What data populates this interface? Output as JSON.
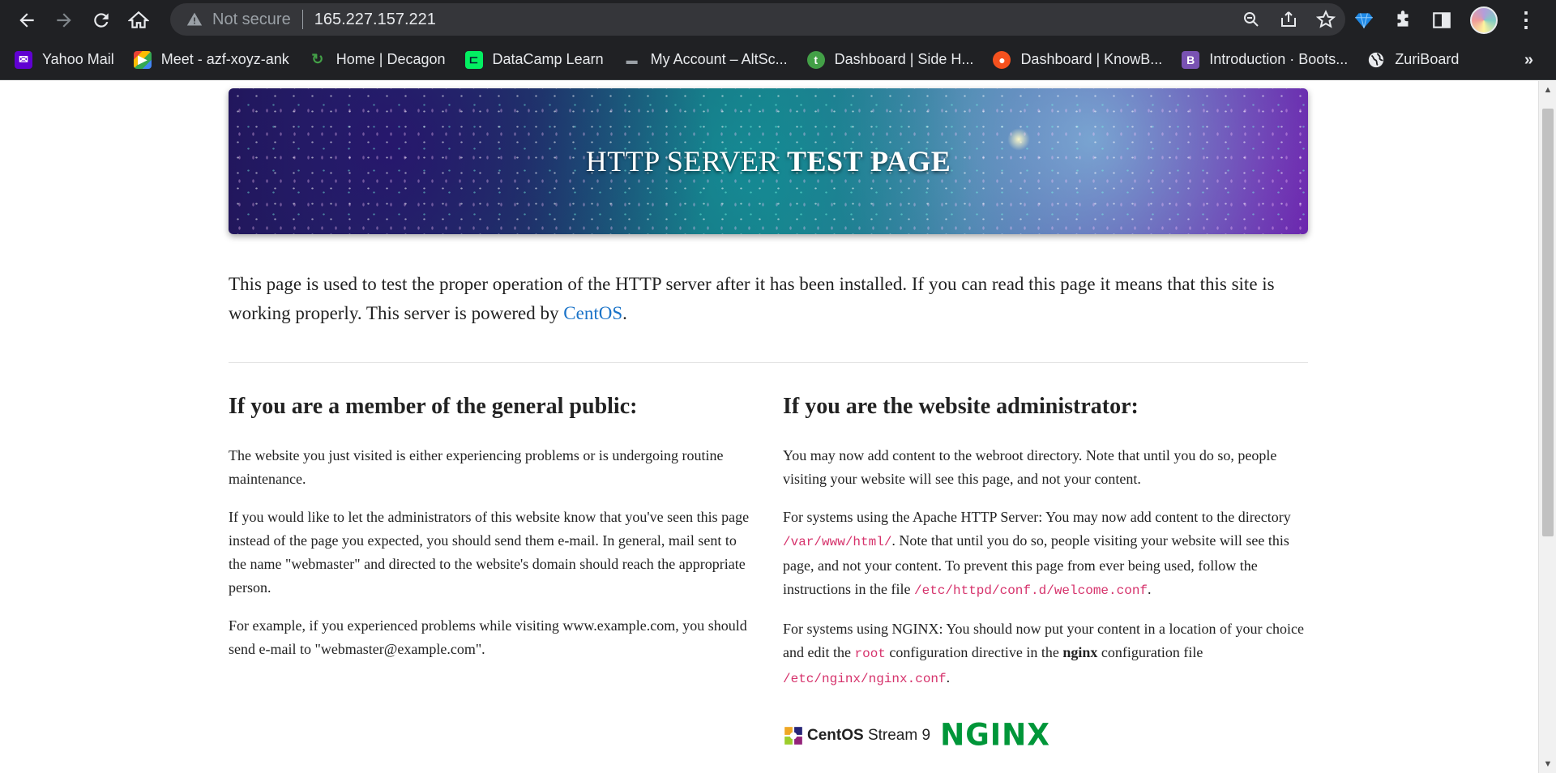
{
  "browser": {
    "security_label": "Not secure",
    "url": "165.227.157.221",
    "bookmarks": [
      {
        "label": "Yahoo Mail",
        "icon": "yahoo-mail-icon",
        "color": "#6001d2"
      },
      {
        "label": "Meet - azf-xoyz-ank",
        "icon": "google-meet-icon",
        "color": "#00897b"
      },
      {
        "label": "Home | Decagon",
        "icon": "decagon-icon",
        "color": "#2e7d32"
      },
      {
        "label": "DataCamp Learn",
        "icon": "datacamp-icon",
        "color": "#03ef62"
      },
      {
        "label": "My Account – AltSc...",
        "icon": "altschool-icon",
        "color": "#3c4043"
      },
      {
        "label": "Dashboard | Side H...",
        "icon": "sidehustle-icon",
        "color": "#43a047"
      },
      {
        "label": "Dashboard | KnowB...",
        "icon": "knowbase-icon",
        "color": "#f4511e"
      },
      {
        "label": "Introduction · Boots...",
        "icon": "bootstrap-icon",
        "color": "#7952b3"
      },
      {
        "label": "ZuriBoard",
        "icon": "globe-icon",
        "color": "#e8eaed"
      }
    ]
  },
  "page": {
    "banner": {
      "title_regular": "HTTP SERVER",
      "title_bold": "TEST PAGE"
    },
    "lead": {
      "text": "This page is used to test the proper operation of the HTTP server after it has been installed. If you can read this page it means that this site is working properly. This server is powered by ",
      "link": "CentOS",
      "end": "."
    },
    "public": {
      "heading": "If you are a member of the general public:",
      "p1": "The website you just visited is either experiencing problems or is undergoing routine maintenance.",
      "p2": "If you would like to let the administrators of this website know that you've seen this page instead of the page you expected, you should send them e-mail. In general, mail sent to the name \"webmaster\" and directed to the website's domain should reach the appropriate person.",
      "p3": "For example, if you experienced problems while visiting www.example.com, you should send e-mail to \"webmaster@example.com\"."
    },
    "admin": {
      "heading": "If you are the website administrator:",
      "p1": "You may now add content to the webroot directory. Note that until you do so, people visiting your website will see this page, and not your content.",
      "p2_a": "For systems using the Apache HTTP Server: You may now add content to the directory ",
      "p2_code1": "/var/www/html/",
      "p2_b": ". Note that until you do so, people visiting your website will see this page, and not your content. To prevent this page from ever being used, follow the instructions in the file ",
      "p2_code2": "/etc/httpd/conf.d/welcome.conf",
      "p2_c": ".",
      "p3_a": "For systems using NGINX: You should now put your content in a location of your choice and edit the ",
      "p3_code1": "root",
      "p3_b": " configuration directive in the ",
      "p3_bold": "nginx",
      "p3_c": " configuration file ",
      "p3_code2": "/etc/nginx/nginx.conf",
      "p3_d": "."
    },
    "logos": {
      "centos_bold": "CentOS",
      "centos_rest": " Stream 9",
      "nginx": "NGINX"
    }
  }
}
